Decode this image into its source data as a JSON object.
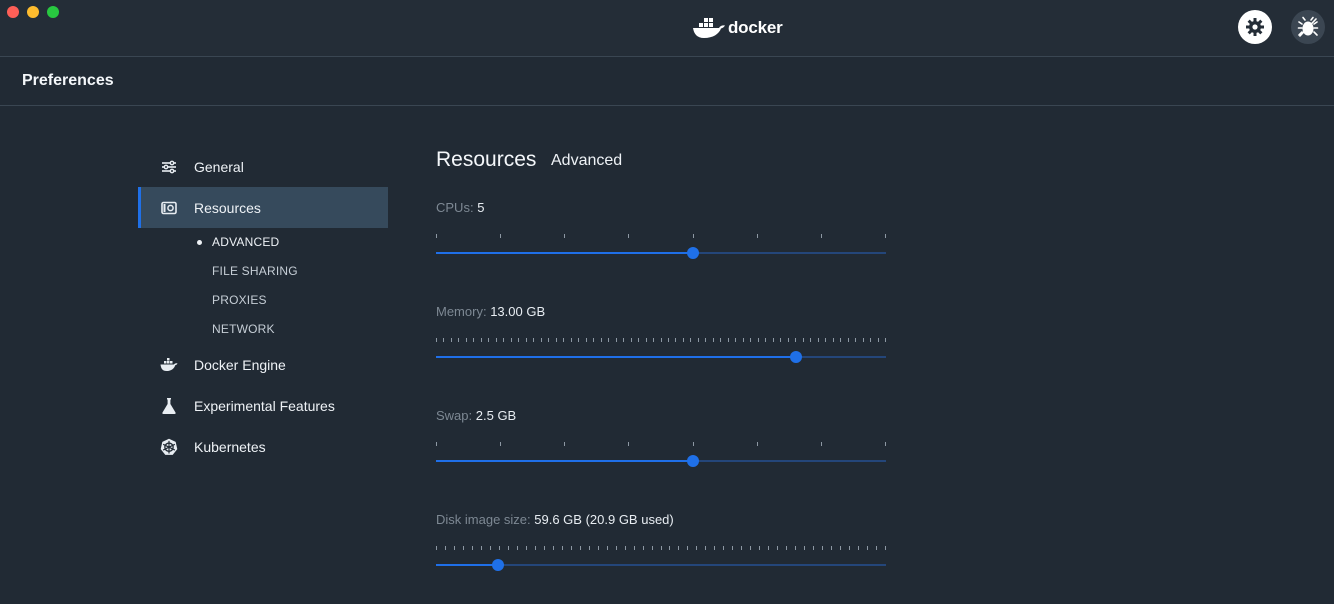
{
  "window": {
    "brand": "docker",
    "settings_icon": "gear-icon",
    "troubleshoot_icon": "bug-icon"
  },
  "header": {
    "title": "Preferences"
  },
  "sidebar": {
    "items": [
      {
        "label": "General",
        "icon": "sliders-icon"
      },
      {
        "label": "Resources",
        "icon": "camera-icon"
      },
      {
        "label": "Docker Engine",
        "icon": "whale-icon"
      },
      {
        "label": "Experimental Features",
        "icon": "flask-icon"
      },
      {
        "label": "Kubernetes",
        "icon": "helm-icon"
      }
    ],
    "subitems": [
      "ADVANCED",
      "FILE SHARING",
      "PROXIES",
      "NETWORK"
    ]
  },
  "main": {
    "title": "Resources",
    "subtitle": "Advanced",
    "settings": [
      {
        "label": "CPUs:",
        "value": "5",
        "level": 0.571,
        "ticks": 8
      },
      {
        "label": "Memory:",
        "value": "13.00 GB",
        "level": 0.8,
        "ticks": 61
      },
      {
        "label": "Swap:",
        "value": "2.5 GB",
        "level": 0.571,
        "ticks": 8
      },
      {
        "label": "Disk image size:",
        "value": "59.6 GB (20.9 GB used)",
        "level": 0.138,
        "ticks": 51
      }
    ]
  },
  "colors": {
    "background": "#212a34",
    "accent": "#1f70e8",
    "active_nav": "#364a5c"
  }
}
